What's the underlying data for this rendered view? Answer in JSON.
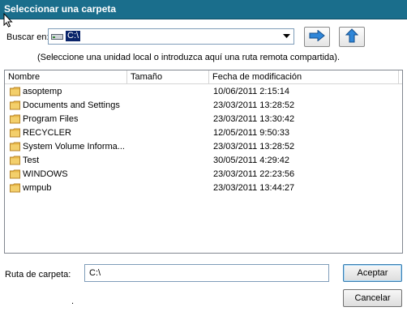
{
  "window": {
    "title": "Seleccionar una carpeta"
  },
  "toolbar": {
    "look_in_label": "Buscar en:",
    "drive_value": "C:\\",
    "go_button_icon": "arrow-right-icon",
    "up_button_icon": "arrow-up-icon"
  },
  "hint": "(Seleccione una unidad local o introduzca aquí una ruta remota compartida).",
  "list": {
    "columns": [
      "Nombre",
      "Tamaño",
      "Fecha de modificación"
    ],
    "rows": [
      {
        "name": "asoptemp",
        "date": "10/06/2011 2:15:14"
      },
      {
        "name": "Documents and Settings",
        "date": "23/03/2011 13:28:52"
      },
      {
        "name": "Program Files",
        "date": "23/03/2011 13:30:42"
      },
      {
        "name": "RECYCLER",
        "date": "12/05/2011 9:50:33"
      },
      {
        "name": "System Volume Informa...",
        "date": "23/03/2011 13:28:52"
      },
      {
        "name": "Test",
        "date": "30/05/2011 4:29:42"
      },
      {
        "name": "WINDOWS",
        "date": "23/03/2011 22:23:56"
      },
      {
        "name": "wmpub",
        "date": "23/03/2011 13:44:27"
      }
    ]
  },
  "footer": {
    "path_label": "Ruta de carpeta:",
    "path_value": "C:\\",
    "accept_label": "Aceptar",
    "cancel_label": "Cancelar",
    "dot": "."
  },
  "colors": {
    "titlebar": "#1a6e8c",
    "selection": "#0a246a",
    "folder": "#e8b84a"
  }
}
